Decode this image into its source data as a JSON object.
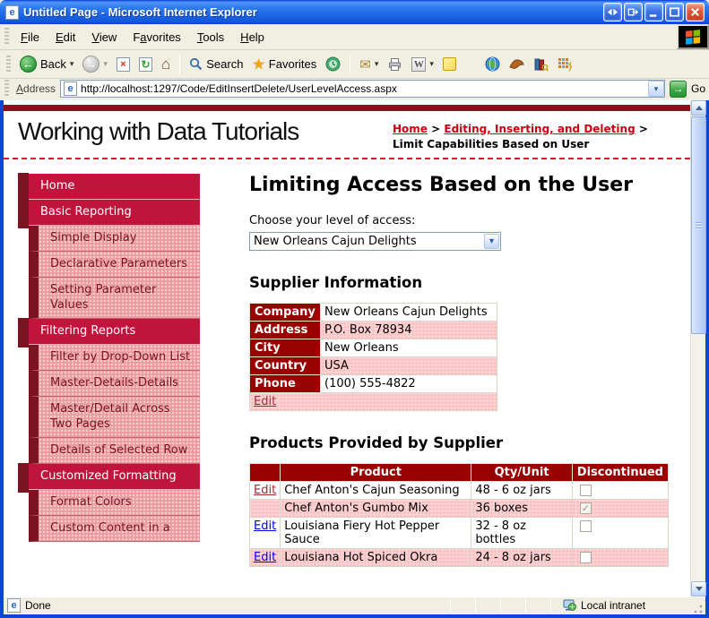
{
  "window": {
    "title": "Untitled Page - Microsoft Internet Explorer"
  },
  "menu": {
    "items": [
      {
        "pre": "",
        "key": "F",
        "post": "ile"
      },
      {
        "pre": "",
        "key": "E",
        "post": "dit"
      },
      {
        "pre": "",
        "key": "V",
        "post": "iew"
      },
      {
        "pre": "F",
        "key": "a",
        "post": "vorites"
      },
      {
        "pre": "",
        "key": "T",
        "post": "ools"
      },
      {
        "pre": "",
        "key": "H",
        "post": "elp"
      }
    ]
  },
  "toolbar": {
    "back": "Back",
    "search": "Search",
    "favorites": "Favorites"
  },
  "address": {
    "label_key": "A",
    "label_post": "ddress",
    "url": "http://localhost:1297/Code/EditInsertDelete/UserLevelAccess.aspx",
    "go": "Go"
  },
  "masthead": {
    "title": "Working with Data Tutorials",
    "breadcrumb": {
      "home": "Home",
      "sep": ">",
      "section": "Editing, Inserting, and Deleting",
      "current": "Limit Capabilities Based on User"
    }
  },
  "sidebar": {
    "items": [
      {
        "label": "Home",
        "level": 1
      },
      {
        "label": "Basic Reporting",
        "level": 1
      },
      {
        "label": "Simple Display",
        "level": 2
      },
      {
        "label": "Declarative Parameters",
        "level": 2
      },
      {
        "label": "Setting Parameter Values",
        "level": 2
      },
      {
        "label": "Filtering Reports",
        "level": 1
      },
      {
        "label": "Filter by Drop-Down List",
        "level": 2
      },
      {
        "label": "Master-Details-Details",
        "level": 2
      },
      {
        "label": "Master/Detail Across Two Pages",
        "level": 2
      },
      {
        "label": "Details of Selected Row",
        "level": 2
      },
      {
        "label": "Customized Formatting",
        "level": 1
      },
      {
        "label": "Format Colors",
        "level": 2
      },
      {
        "label": "Custom Content in a",
        "level": 2
      }
    ]
  },
  "main": {
    "heading": "Limiting Access Based on the User",
    "access_label": "Choose your level of access:",
    "access_value": "New Orleans Cajun Delights"
  },
  "supplier": {
    "heading": "Supplier Information",
    "rows": [
      {
        "label": "Company",
        "value": "New Orleans Cajun Delights"
      },
      {
        "label": "Address",
        "value": "P.O. Box 78934"
      },
      {
        "label": "City",
        "value": "New Orleans"
      },
      {
        "label": "Country",
        "value": "USA"
      },
      {
        "label": "Phone",
        "value": "(100) 555-4822"
      }
    ],
    "edit_label": "Edit"
  },
  "products": {
    "heading": "Products Provided by Supplier",
    "columns": [
      "",
      "Product",
      "Qty/Unit",
      "Discontinued"
    ],
    "rows": [
      {
        "edit": "Edit",
        "edit_class": "red",
        "product": "Chef Anton's Cajun Seasoning",
        "qty": "48 - 6 oz jars",
        "discontinued": false
      },
      {
        "edit": "",
        "edit_class": "",
        "product": "Chef Anton's Gumbo Mix",
        "qty": "36 boxes",
        "discontinued": true
      },
      {
        "edit": "Edit",
        "edit_class": "blue",
        "product": "Louisiana Fiery Hot Pepper Sauce",
        "qty": "32 - 8 oz bottles",
        "discontinued": false
      },
      {
        "edit": "Edit",
        "edit_class": "blue",
        "product": "Louisiana Hot Spiced Okra",
        "qty": "24 - 8 oz jars",
        "discontinued": false
      }
    ]
  },
  "status": {
    "done": "Done",
    "zone": "Local intranet"
  },
  "icons": {
    "ie_letter": "e",
    "back_arrow": "←",
    "forward_arrow": "→",
    "stop_x": "×",
    "refresh": "↻",
    "home": "⌂",
    "star": "★",
    "mail": "✉",
    "caret": "▾",
    "word": "W",
    "go_arrow": "→",
    "select_caret": "▾",
    "check": "✓"
  },
  "colors": {
    "crimson": "#C0143C",
    "dark_maroon": "#7A1421",
    "table_header_red": "#990000",
    "pink_row": "#FFD3D3",
    "sidebar_pink": "#EC9DA2",
    "link_red": "#A52834",
    "link_blue": "#0000E8",
    "crumb_red": "#CC0011"
  }
}
